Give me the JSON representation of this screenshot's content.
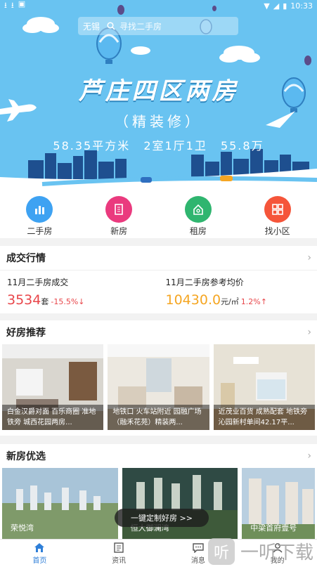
{
  "status_bar": {
    "time": "10:33"
  },
  "search": {
    "city": "无锡",
    "placeholder": "寻找二手房"
  },
  "banner": {
    "title": "芦庄四区两房",
    "subtitle": "（精装修）",
    "specs": "58.35平方米  2室1厅1卫  55.8万"
  },
  "categories": [
    {
      "label": "二手房",
      "icon": "building-chart-icon",
      "color": "#3ea2f2"
    },
    {
      "label": "新房",
      "icon": "building-icon",
      "color": "#ea3a7e"
    },
    {
      "label": "租房",
      "icon": "house-key-icon",
      "color": "#2fb56f"
    },
    {
      "label": "找小区",
      "icon": "grid-icon",
      "color": "#f5553a"
    }
  ],
  "deals": {
    "title": "成交行情",
    "left": {
      "label": "11月二手房成交",
      "value": "3534",
      "unit": "套",
      "change": "-15.5%↓",
      "value_color": "#e8464a"
    },
    "right": {
      "label": "11月二手房参考均价",
      "value": "10430.0",
      "unit": "元/㎡",
      "change": "1.2%↑",
      "value_color": "#f5a623"
    }
  },
  "recommend": {
    "title": "好房推荐",
    "cards": [
      {
        "caption": "白金汉爵对面 百乐商圈 准地铁旁 城西花园两房..."
      },
      {
        "caption": "地铁口 火车站附近 园融广场（融禾花苑）精装两..."
      },
      {
        "caption": "近茂业百货 成熟配套 地铁旁 沁园新村单间42.17平..."
      }
    ]
  },
  "new_homes": {
    "title": "新房优选",
    "cards": [
      {
        "name": "荣悦湾"
      },
      {
        "name": "恒大御澜湾"
      },
      {
        "name": "中梁首府壹号"
      }
    ],
    "custom_button": "一键定制好房 >>"
  },
  "tabs": [
    {
      "label": "首页",
      "icon": "home-icon",
      "active": true
    },
    {
      "label": "资讯",
      "icon": "news-icon",
      "active": false
    },
    {
      "label": "消息",
      "icon": "message-icon",
      "active": false
    },
    {
      "label": "我的",
      "icon": "user-icon",
      "active": false
    }
  ],
  "watermark": {
    "text": "一听下载",
    "logo": "听"
  }
}
